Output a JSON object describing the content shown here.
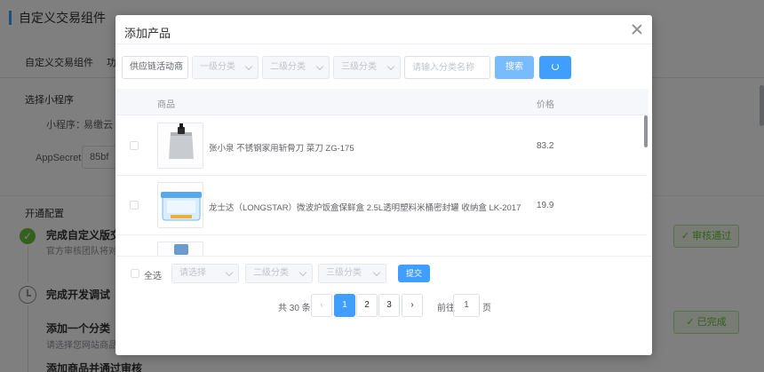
{
  "background": {
    "title": "自定义交易组件",
    "tab_1": "自定义交易组件",
    "tab_2": "功",
    "section_mini": "选择小程序",
    "mini_label": "小程序：",
    "mini_value": "易缴云",
    "appsecret_label": "AppSecret",
    "appsecret_value": "85bf",
    "section_open": "开通配置",
    "steps": [
      {
        "title": "完成自定义版交",
        "desc": "官方审核团队将对"
      },
      {
        "title": "完成开发调试",
        "desc": ""
      },
      {
        "title": "添加一个分类",
        "desc": "请选择您网站商品"
      },
      {
        "title": "添加商品并通过审核",
        "desc": ""
      }
    ],
    "status_approved": "✓ 审核通过",
    "status_done": "✓ 已完成"
  },
  "dialog": {
    "title": "添加产品",
    "filters": {
      "activity": "供应链活动商",
      "cat1": "一级分类",
      "cat2": "二级分类",
      "cat3": "三级分类",
      "search_placeholder": "请输入分类名称",
      "search_button": "搜索"
    },
    "table": {
      "col_product": "商品",
      "col_price": "价格",
      "rows": [
        {
          "name": "张小泉 不锈钢家用斩骨刀 菜刀 ZG-175",
          "price": "83.2"
        },
        {
          "name": "龙士达（LONGSTAR）微波炉饭盒保鲜盒 2.5L透明塑料米桶密封罐 收纳盒 LK-2017",
          "price": "19.9"
        },
        {
          "name": "",
          "price": ""
        }
      ]
    },
    "footer": {
      "select_all": "全选",
      "select_placeholder": "请选择",
      "cat2": "二级分类",
      "cat3": "三级分类",
      "submit": "提交"
    },
    "pagination": {
      "total": "共 30 条",
      "pages": [
        "1",
        "2",
        "3"
      ],
      "current": "1",
      "prev": "‹",
      "next": "›",
      "goto_label": "前往",
      "goto_value": "1",
      "page_unit": "页"
    }
  },
  "colors": {
    "primary": "#409eff",
    "primary_light": "#79bbff",
    "success": "#67c23a"
  }
}
